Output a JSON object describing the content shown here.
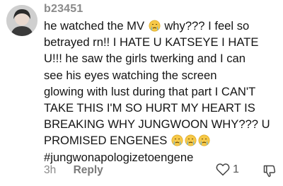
{
  "comment": {
    "username": "b23451",
    "lines": [
      [
        "he watched the MV ",
        {
          "emoji": "crying-face"
        },
        " why??? I feel so"
      ],
      [
        "betrayed rn!! I HATE U KATSEYE I HATE"
      ],
      [
        "U!!! he saw the girls twerking and I can"
      ],
      [
        "see his eyes watching the screen"
      ],
      [
        "glowing with lust during that part I CAN'T"
      ],
      [
        "TAKE THIS I'M SO HURT MY HEART IS"
      ],
      [
        "BREAKING WHY JUNGWOON WHY??? U"
      ],
      [
        "PROMISED ENGENES ",
        {
          "emoji": "crying-face"
        },
        {
          "emoji": "crying-face"
        },
        {
          "emoji": "crying-face"
        }
      ],
      [
        "#jungwonapologizetoengene"
      ]
    ],
    "line_texts": {
      "l1a": "he watched the MV",
      "l1b": "why??? I feel so",
      "l2": "betrayed rn!! I HATE U KATSEYE I HATE",
      "l3": "U!!! he saw the girls twerking and I can",
      "l4": "see his eyes watching the screen",
      "l5": "glowing with lust during that part I CAN'T",
      "l6": "TAKE THIS I'M SO HURT MY HEART IS",
      "l7": "BREAKING WHY JUNGWOON WHY??? U",
      "l8": "PROMISED ENGENES",
      "l9": "#jungwonapologizetoengene"
    },
    "timestamp": "3h",
    "reply_label": "Reply",
    "like_count": "1",
    "icons": {
      "like": "heart-outline-icon",
      "dislike": "thumbs-down-icon",
      "emoji": "crying-face-emoji"
    },
    "colors": {
      "username": "#8a8a8a",
      "text": "#141414",
      "meta": "#8a8a8a"
    }
  }
}
